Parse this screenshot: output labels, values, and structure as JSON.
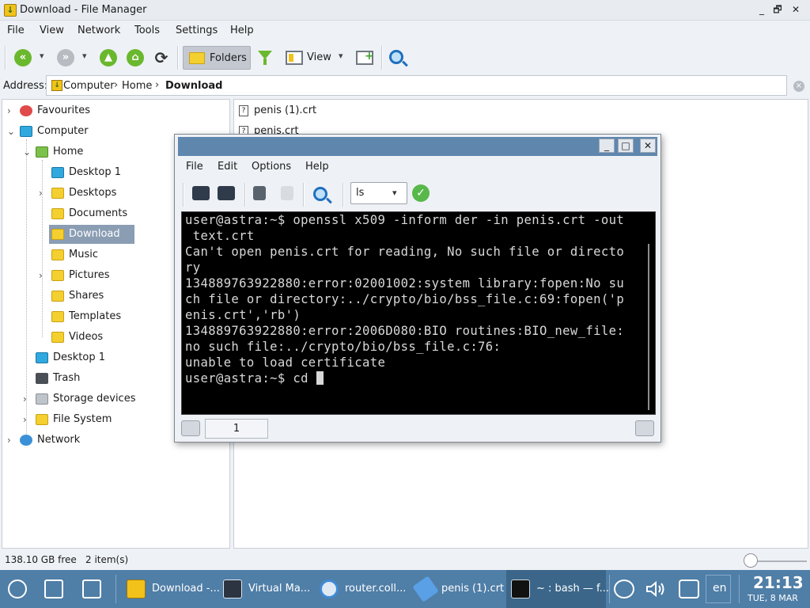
{
  "window": {
    "title": "Download - File Manager",
    "controls": {
      "minimize": "_",
      "maximize": "🗗",
      "close": "✕"
    }
  },
  "menu": [
    "File",
    "View",
    "Network",
    "Tools",
    "Settings",
    "Help"
  ],
  "toolbar": {
    "folders_label": "Folders",
    "view_label": "View"
  },
  "address": {
    "label": "Address:",
    "crumbs": [
      "Computer",
      "Home",
      "Download"
    ]
  },
  "tree": [
    {
      "label": "Favourites",
      "icon": "heart-icon"
    },
    {
      "label": "Computer",
      "icon": "monitor-icon"
    },
    {
      "label": "Home",
      "icon": "home-icon"
    },
    {
      "label": "Desktop 1",
      "icon": "desktop-icon"
    },
    {
      "label": "Desktops",
      "icon": "folder-icon"
    },
    {
      "label": "Documents",
      "icon": "folder-icon"
    },
    {
      "label": "Download",
      "icon": "download-folder-icon",
      "selected": true
    },
    {
      "label": "Music",
      "icon": "music-folder-icon"
    },
    {
      "label": "Pictures",
      "icon": "pictures-folder-icon"
    },
    {
      "label": "Shares",
      "icon": "shares-folder-icon"
    },
    {
      "label": "Templates",
      "icon": "folder-icon"
    },
    {
      "label": "Videos",
      "icon": "video-folder-icon"
    },
    {
      "label": "Desktop 1",
      "icon": "desktop-icon"
    },
    {
      "label": "Trash",
      "icon": "trash-icon"
    },
    {
      "label": "Storage devices",
      "icon": "storage-icon"
    },
    {
      "label": "File System",
      "icon": "folder-icon"
    },
    {
      "label": "Network",
      "icon": "globe-icon"
    }
  ],
  "files": [
    "penis (1).crt",
    "penis.crt"
  ],
  "status": {
    "free": "138.10 GB free",
    "items": "2 item(s)"
  },
  "terminal": {
    "menu": [
      "File",
      "Edit",
      "Options",
      "Help"
    ],
    "command_select": "ls",
    "tab_label": "1",
    "lines": [
      "user@astra:~$ openssl x509 -inform der -in penis.crt -out",
      " text.crt",
      "Can't open penis.crt for reading, No such file or directo",
      "ry",
      "134889763922880:error:02001002:system library:fopen:No su",
      "ch file or directory:../crypto/bio/bss_file.c:69:fopen('p",
      "enis.crt','rb')",
      "134889763922880:error:2006D080:BIO routines:BIO_new_file:",
      "no such file:../crypto/bio/bss_file.c:76:",
      "unable to load certificate"
    ],
    "prompt": "user@astra:~$ cd "
  },
  "taskbar": {
    "tasks": [
      "Download -...",
      "Virtual Ma...",
      "router.coll...",
      "penis (1).crt",
      "~ : bash — f..."
    ],
    "lang": "en",
    "time": "21:13",
    "date": "TUE, 8 MAR"
  },
  "colors": {
    "taskbar": "#4f7ea7",
    "terminal_title": "#5f86ad",
    "selection": "#8a9db3",
    "accent_green": "#6ab82e"
  }
}
